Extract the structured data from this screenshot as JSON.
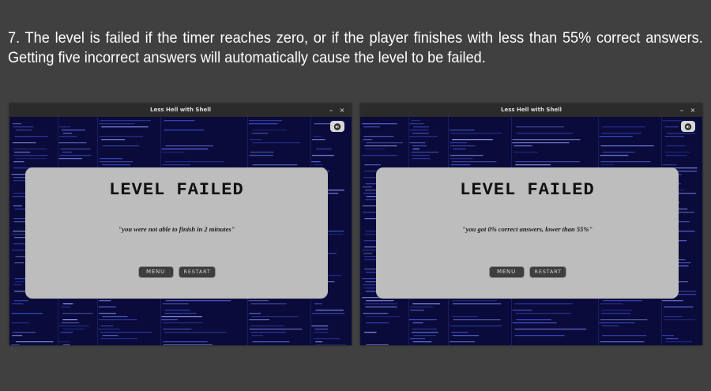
{
  "caption": "7. The level is failed if the timer reaches zero, or if the player finishes with less than 55% correct answers. Getting five incorrect answers will automatically cause the level to be failed.",
  "windows": [
    {
      "title": "Less Hell with Shell",
      "minimize": "–",
      "close": "×",
      "sound_icon": "speaker-icon",
      "modal": {
        "heading": "LEVEL FAILED",
        "message": "\"you were not able to finish in 2 minutes\"",
        "menu_label": "MENU",
        "restart_label": "RESTART"
      }
    },
    {
      "title": "Less Hell with Shell",
      "minimize": "–",
      "close": "×",
      "sound_icon": "speaker-icon",
      "modal": {
        "heading": "LEVEL FAILED",
        "message": "\"you got 0% correct answers, lower than 55%\"",
        "menu_label": "MENU",
        "restart_label": "RESTART"
      }
    }
  ],
  "colors": {
    "page_background": "#404040",
    "game_background": "#0a0b3a",
    "modal_background": "#bdbdbd",
    "button_background": "#3e3e3e"
  }
}
